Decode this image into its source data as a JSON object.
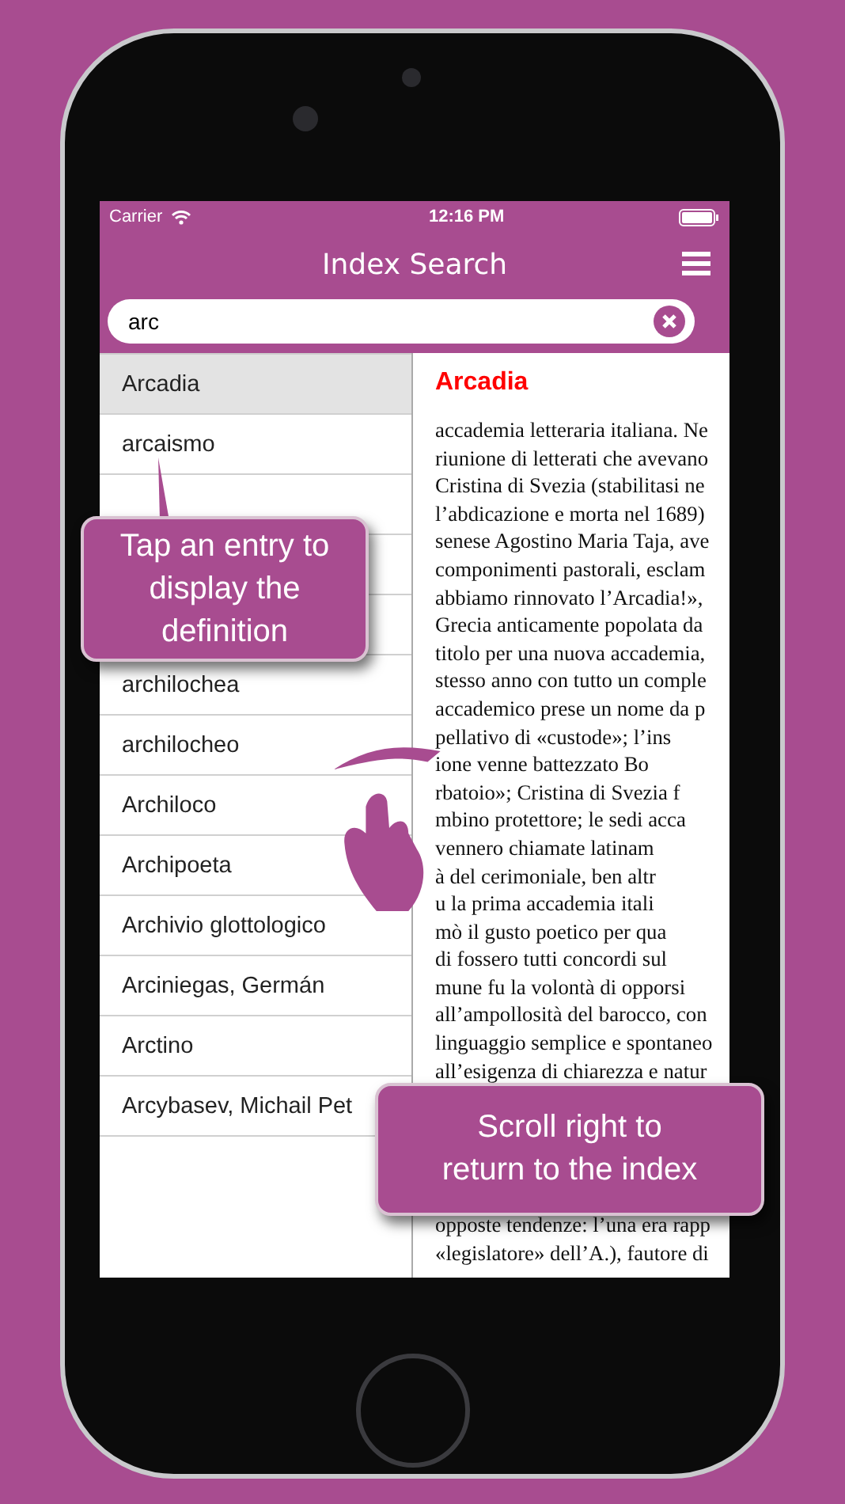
{
  "status_bar": {
    "carrier": "Carrier",
    "time": "12:16 PM"
  },
  "header": {
    "title": "Index Search"
  },
  "search": {
    "value": "arc"
  },
  "index": [
    {
      "label": "Arcadia",
      "selected": true
    },
    {
      "label": "arcaismo",
      "selected": false
    },
    {
      "selected": false
    },
    {
      "selected": false
    },
    {
      "selected": false
    },
    {
      "label": "archilochea",
      "selected": false
    },
    {
      "label": "archilocheo",
      "selected": false
    },
    {
      "label": "Archiloco",
      "selected": false
    },
    {
      "label": "Archipoeta",
      "selected": false
    },
    {
      "label": "Archivio glottologico",
      "selected": false
    },
    {
      "label": "Arciniegas, Germán",
      "selected": false
    },
    {
      "label": "Arctino",
      "selected": false
    },
    {
      "label": "Arcybasev, Michail Pet",
      "selected": false
    }
  ],
  "definition": {
    "title": "Arcadia",
    "lines": [
      "accademia letteraria italiana. Ne",
      "riunione di letterati che avevano",
      "Cristina di Svezia (stabilitasi ne",
      "l’abdicazione e morta nel 1689)",
      "senese Agostino Maria Taja, ave",
      "componimenti pastorali, esclam",
      "abbiamo rinnovato l’Arcadia!»,",
      "Grecia anticamente popolata da",
      "titolo per una nuova accademia,",
      "stesso anno con tutto un comple",
      "accademico prese un nome da p",
      "pellativo di «custode»; l’ins",
      "ione venne battezzato Bo",
      "rbatoio»; Cristina di Svezia f",
      "mbino protettore; le sedi acca",
      "vennero chiamate latinam",
      "à del cerimoniale, ben altr",
      "u la prima accademia itali",
      "mò il gusto poetico per qua",
      "di fossero tutti concordi sul",
      "mune fu la volontà di opporsi",
      "all’ampollosità del barocco, con",
      "linguaggio semplice e spontaneo",
      "all’esigenza di chiarezza e natur"
    ],
    "lines_after": [
      "opposte tendenze: l’una era rapp",
      "«legislatore» dell’A.), fautore di"
    ]
  },
  "callouts": [
    {
      "text": "Tap an entry to display the definition"
    },
    {
      "text": "Scroll right to return to the index"
    }
  ]
}
